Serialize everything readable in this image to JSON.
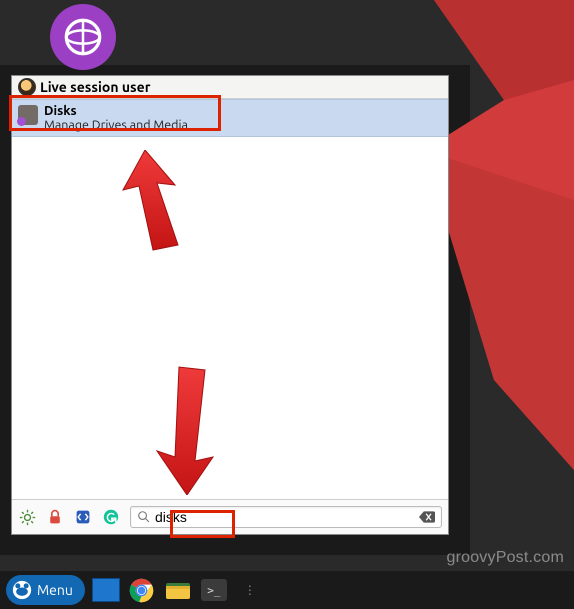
{
  "header": {
    "user_label": "Live session user"
  },
  "result": {
    "name": "Disks",
    "description": "Manage Drives and Media"
  },
  "search": {
    "value": "disks"
  },
  "taskbar": {
    "menu_label": "Menu"
  },
  "watermark": "groovyPost.com"
}
